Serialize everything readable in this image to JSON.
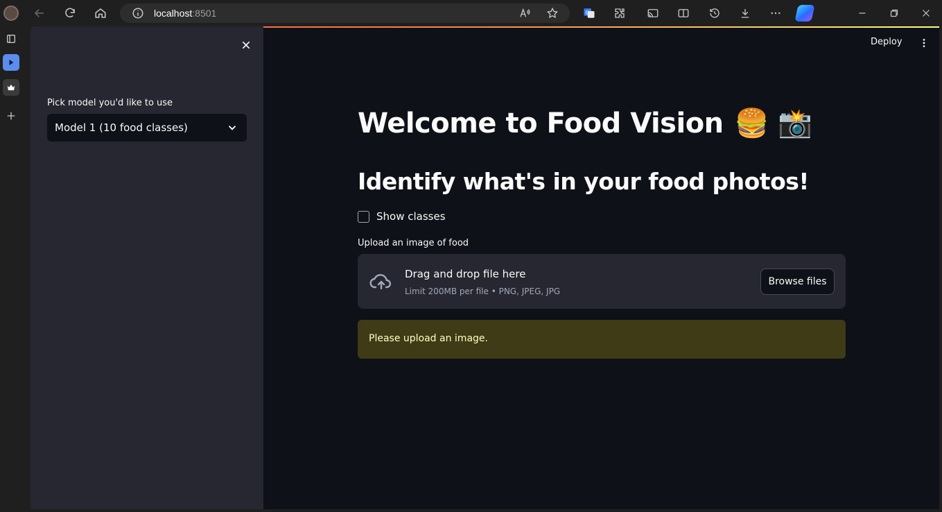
{
  "browser": {
    "url_host": "localhost",
    "url_port": ":8501"
  },
  "sidebar": {
    "select_label": "Pick model you'd like to use",
    "select_value": "Model 1 (10 food classes)"
  },
  "header": {
    "deploy_label": "Deploy"
  },
  "main": {
    "title": "Welcome to Food Vision",
    "title_emojis": "🍔 📸",
    "subtitle": "Identify what's in your food photos!",
    "checkbox_label": "Show classes",
    "upload_label": "Upload an image of food",
    "dropzone_title": "Drag and drop file here",
    "dropzone_sub": "Limit 200MB per file • PNG, JPEG, JPG",
    "browse_label": "Browse files",
    "alert_text": "Please upload an image."
  },
  "colors": {
    "app_bg": "#0e1117",
    "sidebar_bg": "#262730",
    "warning_bg": "#3e3b16",
    "warning_text": "#ffffc2"
  }
}
